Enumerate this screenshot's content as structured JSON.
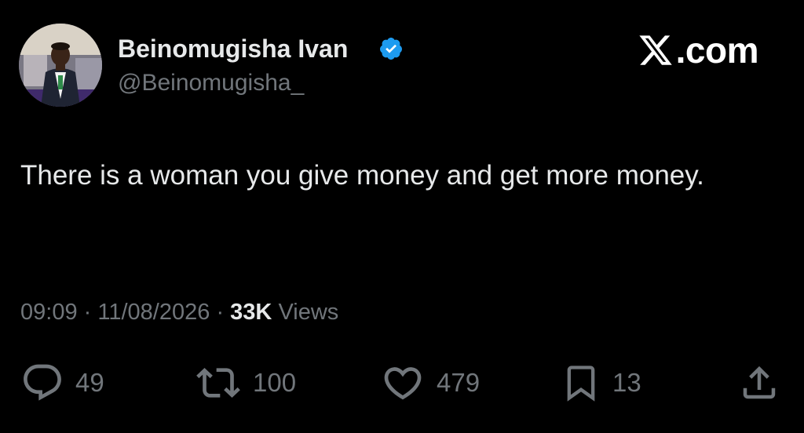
{
  "author": {
    "display_name": "Beinomugisha Ivan",
    "handle": "@Beinomugisha_",
    "verified": true,
    "avatar": "avatar-photo"
  },
  "brand": {
    "logo": "x-logo-icon",
    "text": ".com"
  },
  "tweet": {
    "text": "There is a woman you give money and get more money.",
    "time": "09:09",
    "separator": "·",
    "date": "11/08/2026",
    "views_count": "33K",
    "views_label": "Views"
  },
  "actions": {
    "reply": {
      "icon": "reply-icon",
      "count": "49"
    },
    "retweet": {
      "icon": "retweet-icon",
      "count": "100"
    },
    "like": {
      "icon": "heart-icon",
      "count": "479"
    },
    "bookmark": {
      "icon": "bookmark-icon",
      "count": "13"
    },
    "share": {
      "icon": "share-icon"
    }
  },
  "colors": {
    "background": "#000000",
    "primary_text": "#e7e9ea",
    "secondary_text": "#71767b",
    "verified_badge": "#1d9bf0"
  }
}
